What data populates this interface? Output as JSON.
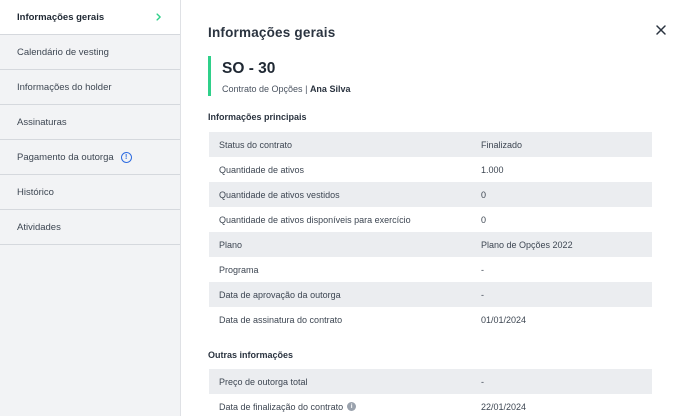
{
  "sidebar": {
    "items": [
      {
        "label": "Informações gerais"
      },
      {
        "label": "Calendário de vesting"
      },
      {
        "label": "Informações do holder"
      },
      {
        "label": "Assinaturas"
      },
      {
        "label": "Pagamento da outorga"
      },
      {
        "label": "Histórico"
      },
      {
        "label": "Atividades"
      }
    ]
  },
  "header": {
    "title": "Informações gerais"
  },
  "contract": {
    "id": "SO - 30",
    "type": "Contrato de Opções",
    "separator": "|",
    "holder": "Ana Silva"
  },
  "principais": {
    "title": "Informações principais",
    "rows": [
      {
        "label": "Status do contrato",
        "value": "Finalizado"
      },
      {
        "label": "Quantidade de ativos",
        "value": "1.000"
      },
      {
        "label": "Quantidade de ativos vestidos",
        "value": "0"
      },
      {
        "label": "Quantidade de ativos disponíveis para exercício",
        "value": "0"
      },
      {
        "label": "Plano",
        "value": "Plano de Opções 2022"
      },
      {
        "label": "Programa",
        "value": "-"
      },
      {
        "label": "Data de aprovação da outorga",
        "value": "-"
      },
      {
        "label": "Data de assinatura do contrato",
        "value": "01/01/2024"
      }
    ]
  },
  "outras": {
    "title": "Outras informações",
    "rows": [
      {
        "label": "Preço de outorga total",
        "value": "-"
      },
      {
        "label": "Data de finalização do contrato",
        "value": "22/01/2024"
      }
    ]
  },
  "colors": {
    "accent": "#2fd08a",
    "info_blue": "#2d6be0",
    "row_shade": "#ebedf0",
    "sidebar_bg": "#f2f3f5"
  }
}
